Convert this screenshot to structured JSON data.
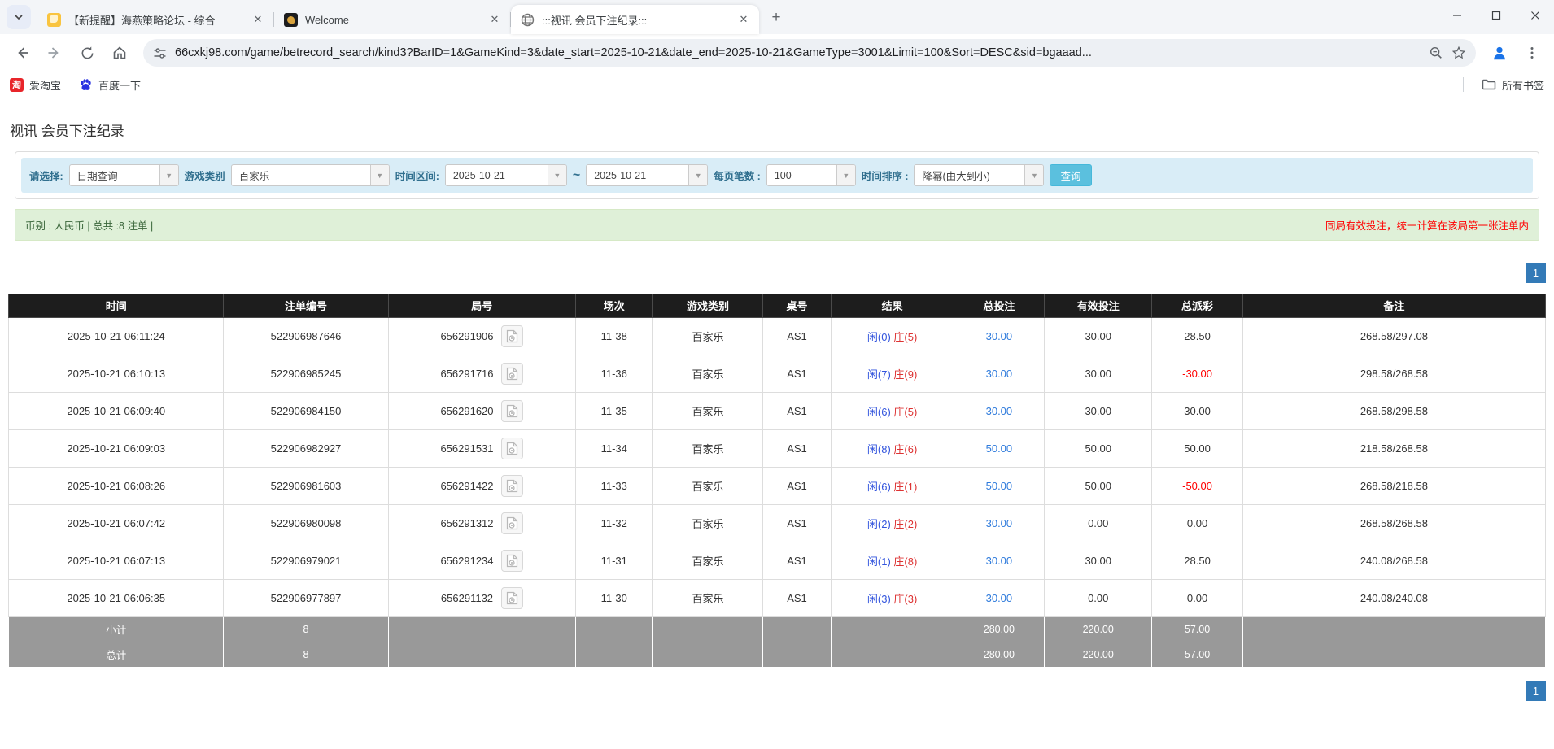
{
  "browser": {
    "tabs": [
      {
        "title": "【新提醒】海燕策略论坛 - 综合",
        "active": false
      },
      {
        "title": "Welcome",
        "active": false
      },
      {
        "title": ":::视讯 会员下注纪录:::",
        "active": true
      }
    ],
    "url": "66cxkj98.com/game/betrecord_search/kind3?BarID=1&GameKind=3&date_start=2025-10-21&date_end=2025-10-21&GameType=3001&Limit=100&Sort=DESC&sid=bgaaad...",
    "bookmarks": [
      {
        "label": "爱淘宝",
        "badge": "淘"
      },
      {
        "label": "百度一下"
      }
    ],
    "all_bookmarks_label": "所有书签"
  },
  "icons": {
    "tab-search": "chevron-down",
    "new-tab": "plus",
    "back": "arrow-left",
    "forward": "arrow-right",
    "reload": "circular-arrow",
    "home": "house",
    "site-info": "tune-sliders",
    "zoom": "magnifier",
    "bookmark-star": "star-outline",
    "profile": "person",
    "menu": "three-dots-vertical",
    "window": "minimize / maximize / close",
    "baidu": "paw-print",
    "all-bookmarks": "folder",
    "round-video": "film-document"
  },
  "colors": {
    "accent_blue": "#337ab7",
    "link_blue": "#2f7bdc",
    "player_blue": "#3355dd",
    "banker_red": "#dd3333",
    "negative_red": "#ff0000",
    "filter_bg": "#d9edf7",
    "summary_bg": "#dff0d8",
    "table_header_bg": "#1d1d1d",
    "table_footer_bg": "#999999",
    "search_btn": "#5bc0de"
  },
  "page": {
    "title": "视讯 会员下注纪录",
    "filters": {
      "select_label": "请选择:",
      "select_value": "日期查询",
      "game_label": "游戏类别",
      "game_value": "百家乐",
      "range_label": "时间区间:",
      "date_start": "2025-10-21",
      "tilde": "~",
      "date_end": "2025-10-21",
      "per_page_label": "每页笔数 :",
      "per_page_value": "100",
      "sort_label": "时间排序 :",
      "sort_value": "降幂(由大到小)",
      "search_button": "查询"
    },
    "summary_left": "币别 : 人民币 | 总共 :8 注单 |",
    "summary_right": "同局有效投注，统一计算在该局第一张注单内",
    "pagination": "1"
  },
  "table": {
    "headers": [
      "时间",
      "注单编号",
      "局号",
      "场次",
      "游戏类别",
      "桌号",
      "结果",
      "总投注",
      "有效投注",
      "总派彩",
      "备注"
    ],
    "rows": [
      {
        "time": "2025-10-21 06:11:24",
        "bet_id": "522906987646",
        "round": "656291906",
        "session": "11-38",
        "game": "百家乐",
        "table_no": "AS1",
        "player": "闲(0)",
        "banker": "庄(5)",
        "total_bet": "30.00",
        "valid_bet": "30.00",
        "payout": "28.50",
        "remark": "268.58/297.08"
      },
      {
        "time": "2025-10-21 06:10:13",
        "bet_id": "522906985245",
        "round": "656291716",
        "session": "11-36",
        "game": "百家乐",
        "table_no": "AS1",
        "player": "闲(7)",
        "banker": "庄(9)",
        "total_bet": "30.00",
        "valid_bet": "30.00",
        "payout": "-30.00",
        "remark": "298.58/268.58"
      },
      {
        "time": "2025-10-21 06:09:40",
        "bet_id": "522906984150",
        "round": "656291620",
        "session": "11-35",
        "game": "百家乐",
        "table_no": "AS1",
        "player": "闲(6)",
        "banker": "庄(5)",
        "total_bet": "30.00",
        "valid_bet": "30.00",
        "payout": "30.00",
        "remark": "268.58/298.58"
      },
      {
        "time": "2025-10-21 06:09:03",
        "bet_id": "522906982927",
        "round": "656291531",
        "session": "11-34",
        "game": "百家乐",
        "table_no": "AS1",
        "player": "闲(8)",
        "banker": "庄(6)",
        "total_bet": "50.00",
        "valid_bet": "50.00",
        "payout": "50.00",
        "remark": "218.58/268.58"
      },
      {
        "time": "2025-10-21 06:08:26",
        "bet_id": "522906981603",
        "round": "656291422",
        "session": "11-33",
        "game": "百家乐",
        "table_no": "AS1",
        "player": "闲(6)",
        "banker": "庄(1)",
        "total_bet": "50.00",
        "valid_bet": "50.00",
        "payout": "-50.00",
        "remark": "268.58/218.58"
      },
      {
        "time": "2025-10-21 06:07:42",
        "bet_id": "522906980098",
        "round": "656291312",
        "session": "11-32",
        "game": "百家乐",
        "table_no": "AS1",
        "player": "闲(2)",
        "banker": "庄(2)",
        "total_bet": "30.00",
        "valid_bet": "0.00",
        "payout": "0.00",
        "remark": "268.58/268.58"
      },
      {
        "time": "2025-10-21 06:07:13",
        "bet_id": "522906979021",
        "round": "656291234",
        "session": "11-31",
        "game": "百家乐",
        "table_no": "AS1",
        "player": "闲(1)",
        "banker": "庄(8)",
        "total_bet": "30.00",
        "valid_bet": "30.00",
        "payout": "28.50",
        "remark": "240.08/268.58"
      },
      {
        "time": "2025-10-21 06:06:35",
        "bet_id": "522906977897",
        "round": "656291132",
        "session": "11-30",
        "game": "百家乐",
        "table_no": "AS1",
        "player": "闲(3)",
        "banker": "庄(3)",
        "total_bet": "30.00",
        "valid_bet": "0.00",
        "payout": "0.00",
        "remark": "240.08/240.08"
      }
    ],
    "subtotal": {
      "label": "小计",
      "count": "8",
      "total_bet": "280.00",
      "valid_bet": "220.00",
      "payout": "57.00"
    },
    "total": {
      "label": "总计",
      "count": "8",
      "total_bet": "280.00",
      "valid_bet": "220.00",
      "payout": "57.00"
    }
  }
}
